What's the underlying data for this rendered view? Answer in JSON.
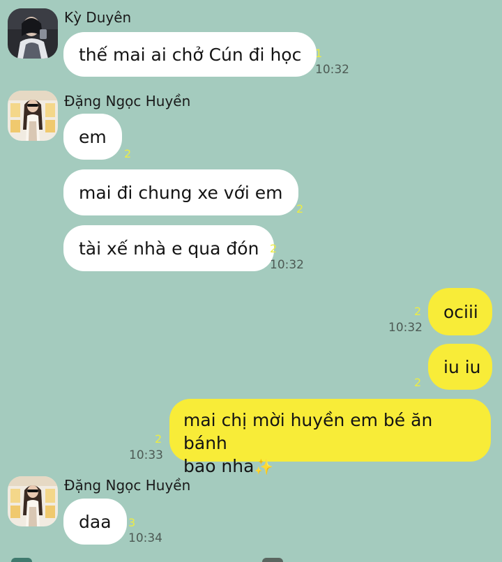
{
  "chat": {
    "senders": {
      "ky_duyen": "Kỳ Duyên",
      "dang_ngoc_huyen": "Đặng Ngọc Huyền"
    },
    "messages": [
      {
        "text": "thế mai ai chở Cún đi học",
        "read_count": "1",
        "time": "10:32"
      },
      {
        "text": "em",
        "read_count": "2"
      },
      {
        "text": "mai đi chung xe với em",
        "read_count": "2"
      },
      {
        "text": "tài xế nhà e qua đón",
        "read_count": "2",
        "time": "10:32"
      },
      {
        "text": "ociii",
        "read_count": "2",
        "time": "10:32"
      },
      {
        "text": "iu iu",
        "read_count": "2"
      },
      {
        "text_line1": "mai chị mời huyền em bé ăn bánh",
        "text_line2": "bao nha",
        "emoji": "✨",
        "read_count": "2",
        "time": "10:33"
      },
      {
        "text": "daa",
        "read_count": "3",
        "time": "10:34"
      }
    ]
  },
  "colors": {
    "background": "#a4cbbe",
    "incoming_bubble": "#ffffff",
    "outgoing_bubble": "#f8ec38",
    "read_count": "#ecec44"
  },
  "icons": {
    "avatar_ky_duyen": "avatar",
    "avatar_huyen": "avatar"
  }
}
